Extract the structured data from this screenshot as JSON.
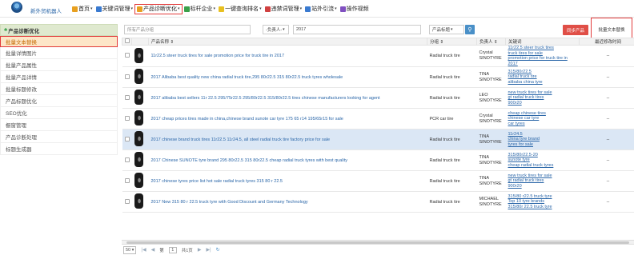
{
  "brand": "新外贸机器人",
  "nav": [
    {
      "label": "首页",
      "color": "#e8a020"
    },
    {
      "label": "关键词管理",
      "color": "#3a7ad0"
    },
    {
      "label": "产品诊断优化",
      "color": "#e8a020"
    },
    {
      "label": "标杆企业",
      "color": "#3aa04a"
    },
    {
      "label": "一键查询排名",
      "color": "#e8c020"
    },
    {
      "label": "违禁词管理",
      "color": "#d04040"
    },
    {
      "label": "站外引流",
      "color": "#3a7ad0"
    },
    {
      "label": "操作视频",
      "color": "#8050c0"
    }
  ],
  "sidebar": {
    "header": "产品诊断优化",
    "items": [
      "批量文本替换",
      "批量详情图片",
      "批量产品属性",
      "批量产品详情",
      "批量标题修改",
      "产品标题优化",
      "SEO优化",
      "橱窗管理",
      "产品诊断处理",
      "标题生成器"
    ]
  },
  "filters": {
    "group_placeholder": "所有产品分组",
    "owner": "-负责人-",
    "year": "2017",
    "title_field": "产品标题",
    "sync_button": "同步产品",
    "batch_replace_button": "批量文本替换"
  },
  "table": {
    "headers": [
      "产品名称 ⇕",
      "分组 ⇕",
      "负责人 ⇕",
      "关键词",
      "最近修改时间"
    ],
    "rows": [
      {
        "name": "11r22.5 steer truck tires for sale promotion price for truck tire in 2017",
        "group": "Radial truck tire",
        "owner": [
          "Crystal",
          "SINOTYRE"
        ],
        "keywords": [
          "11r22.5 steer truck tires",
          "truck tires for sale",
          "promotion price for truck tire in",
          "2017"
        ],
        "time": "--"
      },
      {
        "name": "2017 Alibaba best quality new china radial truck tire,295 80r22.5 315 80r22.5 truck tyres wholesale",
        "group": "Radial truck tire",
        "owner": [
          "TINA",
          "SINOTYRE"
        ],
        "keywords": [
          "315/80r22.5",
          "radial truck tire",
          "alibaba china tyre"
        ],
        "time": "--"
      },
      {
        "name": "2017 alibaba best sellers 11r 22.5 295/75r22.5 295/80r22.5 315/80r22.5 tires chinese manufacturers looking for agent",
        "group": "Radial truck tire",
        "owner": [
          "LEO",
          "SINOTYRE"
        ],
        "keywords": [
          "new truck tires for sale",
          "gt radial truck tires",
          "900r20"
        ],
        "time": "--"
      },
      {
        "name": "2017 cheap prices tires made in china,chinese brand sunote car tyre 175 65 r14 195/65r15 for sale",
        "group": "PCR car tire",
        "owner": [
          "Crystal",
          "SINOTYRE"
        ],
        "keywords": [
          "cheap chinese tires",
          "chinese car tyre",
          "car tyres"
        ],
        "time": "--"
      },
      {
        "name": "2017 chinese brand truck tires 11r22.5 11r24.5, all steel radial truck tire factory price for sale",
        "group": "Radial truck tire",
        "owner": [
          "TINA",
          "SINOTYRE"
        ],
        "keywords": [
          "11r24.5",
          "china tyre brand",
          "tyres for sale"
        ],
        "time": "--"
      },
      {
        "name": "2017 Chinese SUNOTE tyre brand 295 80r22.5 315 80r22.5 cheap radial truck tyres with best quality",
        "group": "Radial truck tire",
        "owner": [
          "TINA",
          "SINOTYRE"
        ],
        "keywords": [
          "315/80r22.5-20",
          "sunote tyre",
          "cheap radial truck tyres"
        ],
        "time": "--"
      },
      {
        "name": "2017 chinese tyres price list hot sale radial truck tyres 315 80 r 22.5",
        "group": "Radial truck tire",
        "owner": [
          "TINA",
          "SINOTYRE"
        ],
        "keywords": [
          "new truck tires for sale",
          "gt radial truck tires",
          "900r20"
        ],
        "time": "--"
      },
      {
        "name": "2017 New 315 80 r 22.5 truck tyre with Good Discount and Germany Technology",
        "group": "Radial truck tire",
        "owner": [
          "MICHAEL",
          "SINOTYRE"
        ],
        "keywords": [
          "315/80 r22.5 truck tyre",
          "Top 10 tyre brands",
          "315/80r 22.5 truck tyre"
        ],
        "time": "--"
      }
    ],
    "selected_row": 4
  },
  "pager": {
    "page_size": "50 ▾",
    "page_label": "第",
    "page": "1",
    "total": "共1页"
  }
}
